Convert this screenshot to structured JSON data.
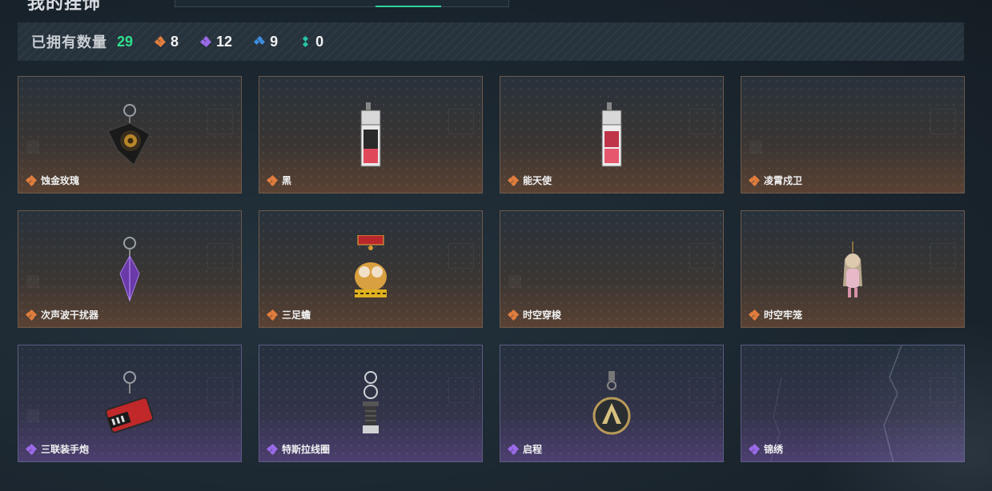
{
  "header": {
    "title": "我的挂饰"
  },
  "summary": {
    "label": "已拥有数量",
    "total": "29",
    "counters": [
      {
        "rarity": "orange",
        "icon": "orange-gem-icon",
        "count": "8"
      },
      {
        "rarity": "purple",
        "icon": "purple-gem-icon",
        "count": "12"
      },
      {
        "rarity": "blue",
        "icon": "blue-gem-icon",
        "count": "9"
      },
      {
        "rarity": "teal",
        "icon": "teal-gem-icon",
        "count": "0"
      }
    ]
  },
  "items": [
    {
      "name": "蚀金玫瑰",
      "rarity": "orange",
      "icon": "rose-charm-icon"
    },
    {
      "name": "黑",
      "rarity": "orange",
      "icon": "card-charm-icon"
    },
    {
      "name": "能天使",
      "rarity": "orange",
      "icon": "card-charm-icon"
    },
    {
      "name": "凌霄戍卫",
      "rarity": "orange",
      "icon": ""
    },
    {
      "name": "次声波干扰器",
      "rarity": "orange",
      "icon": "crystal-charm-icon"
    },
    {
      "name": "三足蟾",
      "rarity": "orange",
      "icon": "toad-charm-icon"
    },
    {
      "name": "时空穿梭",
      "rarity": "orange",
      "icon": ""
    },
    {
      "name": "时空牢笼",
      "rarity": "orange",
      "icon": "doll-charm-icon"
    },
    {
      "name": "三联装手炮",
      "rarity": "purple",
      "icon": "cannon-charm-icon"
    },
    {
      "name": "特斯拉线圈",
      "rarity": "purple",
      "icon": "coil-charm-icon"
    },
    {
      "name": "启程",
      "rarity": "purple",
      "icon": "medal-charm-icon"
    },
    {
      "name": "锦绣",
      "rarity": "purple",
      "icon": ""
    }
  ],
  "colors": {
    "accent_green": "#2fe08d",
    "orange_rarity": "#e07d3e",
    "purple_rarity": "#9a6ae8",
    "blue_rarity": "#3c8fe0",
    "teal_rarity": "#25c7a6"
  }
}
